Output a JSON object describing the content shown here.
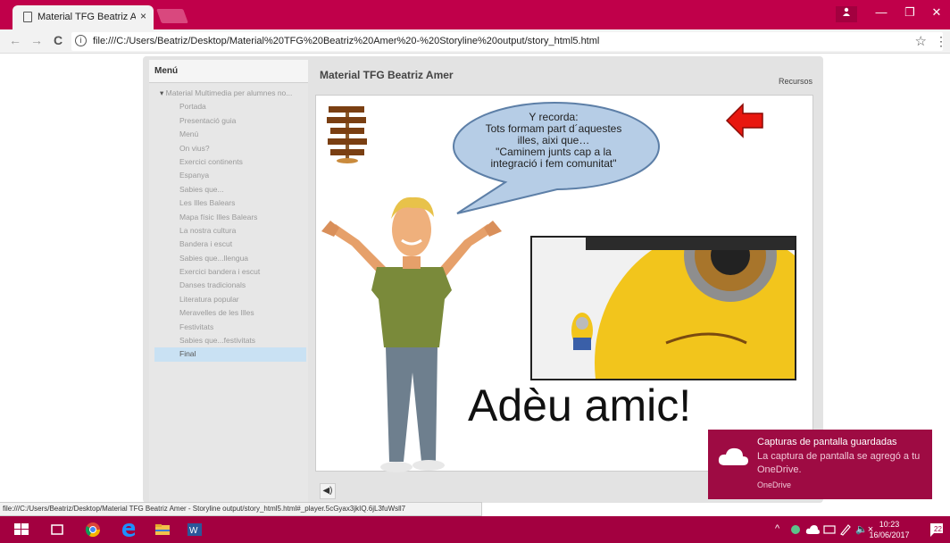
{
  "browser": {
    "tab_title": "Material TFG Beatriz Ame",
    "tab_close": "×",
    "address": "file:///C:/Users/Beatriz/Desktop/Material%20TFG%20Beatriz%20Amer%20-%20Storyline%20output/story_html5.html",
    "info_glyph": "i",
    "back_glyph": "←",
    "forward_glyph": "→",
    "reload_glyph": "C",
    "star_glyph": "☆",
    "menu_glyph": "⋮",
    "minimize_glyph": "—",
    "restore_glyph": "❐",
    "close_glyph": "✕",
    "status_url": "file:///C:/Users/Beatriz/Desktop/Material TFG Beatriz Amer - Storyline output/story_html5.html#_player.5cGyax3jkIQ.6jL3fuWsll7"
  },
  "player": {
    "menu_tab_label": "Menú",
    "course_title": "Material TFG Beatriz Amer",
    "resources_label": "Recursos",
    "menu_items": [
      {
        "label": "Material Multimedia per alumnes no...",
        "root": true
      },
      {
        "label": "Portada"
      },
      {
        "label": "Presentació guia"
      },
      {
        "label": "Menú"
      },
      {
        "label": "On vius?"
      },
      {
        "label": "Exercici continents"
      },
      {
        "label": "Espanya"
      },
      {
        "label": "Sabies que..."
      },
      {
        "label": "Les Illes Balears"
      },
      {
        "label": "Mapa físic Illes Balears"
      },
      {
        "label": "La nostra cultura"
      },
      {
        "label": "Bandera i escut"
      },
      {
        "label": "Sabies que...llengua"
      },
      {
        "label": "Exercici bandera i escut"
      },
      {
        "label": "Danses tradicionals"
      },
      {
        "label": "Literatura popular"
      },
      {
        "label": "Meravelles de les Illes"
      },
      {
        "label": "Festivitats"
      },
      {
        "label": "Sabies que...festivitats"
      },
      {
        "label": "Final",
        "active": true
      }
    ],
    "volume_glyph": "◀)"
  },
  "slide": {
    "bubble_lines": [
      "Y recorda:",
      "Tots formam part d´aquestes",
      "illes, aixi que…",
      "\"Caminem junts cap a la",
      "integració i fem comunitat\""
    ],
    "farewell": "Adèu amic!",
    "arrow_color": "#e8170f"
  },
  "toast": {
    "title": "Capturas de pantalla guardadas",
    "body": "La captura de pantalla se agregó a tu OneDrive.",
    "app": "OneDrive"
  },
  "taskbar": {
    "tray_glyphs": "^",
    "volume_glyph": "🔈×",
    "time": "10:23",
    "date": "16/06/2017",
    "notifications": "22",
    "color": "#a30040"
  }
}
